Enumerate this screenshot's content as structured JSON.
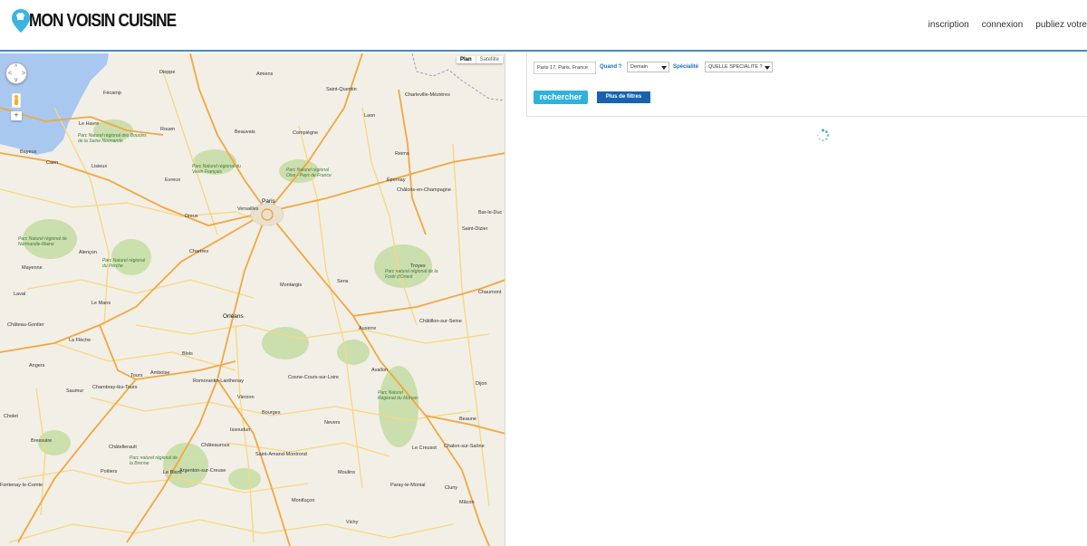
{
  "header": {
    "logo_text": "MON VOISIN CUISINE",
    "nav": [
      {
        "label": "inscription"
      },
      {
        "label": "connexion"
      },
      {
        "label": "publiez votre"
      }
    ]
  },
  "map": {
    "map_types": {
      "active": "Plan",
      "inactive": "Satellite"
    },
    "zoom_in": "+",
    "cities": [
      "Amiens",
      "Saint-Quentin",
      "Dieppe",
      "Fécamp",
      "Le Havre",
      "Rouen",
      "Beauvais",
      "Compiègne",
      "Laon",
      "Charleville-Mézières",
      "Reims",
      "Épernay",
      "Châlons-en-Champagne",
      "Paris",
      "Versailles",
      "Evreux",
      "Dreux",
      "Caen",
      "Lisieux",
      "Bayeux",
      "Chartres",
      "Alençon",
      "Mayenne",
      "Laval",
      "Le Mans",
      "Château-Gontier",
      "La Flèche",
      "Angers",
      "Saumur",
      "Tours",
      "Amboise",
      "Blois",
      "Orléans",
      "Romorantin-Lanthenay",
      "Vierzon",
      "Bourges",
      "Issoudun",
      "Châteauroux",
      "Poitiers",
      "Bressuire",
      "Cholet",
      "Châtellerault",
      "Montluçon",
      "Moulins",
      "Vichy",
      "Nevers",
      "Auxerre",
      "Sens",
      "Troyes",
      "Avallon",
      "Dijon",
      "Beaune",
      "Le Creusot",
      "Chalon-sur-Saône",
      "Mâcon",
      "Paray-le-Monial",
      "Cluny",
      "Chaumont",
      "Saint-Dizier",
      "Bar-le-Duc",
      "Châtillon-sur-Seine",
      "Cosne-Cours-sur-Loire",
      "Saint-Amand-Montrond",
      "Argenton-sur-Creuse",
      "Le Blanc",
      "Chambray-lès-Tours",
      "Montargis",
      "Fontenay-le-Comte"
    ],
    "parks": [
      "Parc Naturel régional des Boucles de la Seine Normande",
      "Parc Naturel régional du Vexin Français",
      "Parc Naturel régional Oise - Pays de France",
      "Parc Naturel régional de Normandie-Maine",
      "Parc Naturel régional du Perche",
      "Parc naturel régional de la Forêt d'Orient",
      "Parc Naturel Régional du Morvan",
      "Parc naturel régional de la Brenne"
    ]
  },
  "search": {
    "location_value": "Paris 17, Paris, France",
    "quand_label": "Quand ?",
    "quand_value": "Demain",
    "specialite_label": "Spécialité",
    "specialite_value": "QUELLE SPECIALITE ?",
    "search_button": "rechercher",
    "filters_button": "Plus de filtres"
  },
  "colors": {
    "accent_blue": "#1763b0",
    "search_button": "#2fb3dd",
    "label_blue": "#1a6ec4",
    "logo_pin": "#3bb5e0",
    "header_rule": "#4a89c5",
    "road_orange": "#f2a742",
    "road_yellow": "#f8d77f",
    "park_green": "#c9deaa",
    "map_land": "#f2efe6",
    "sea": "#a8c8f0"
  },
  "icons": {
    "logo": "map-pin-chef-icon",
    "pan": "pan-control-icon",
    "pegman": "street-view-pegman-icon",
    "loading": "loading-spinner-icon"
  }
}
